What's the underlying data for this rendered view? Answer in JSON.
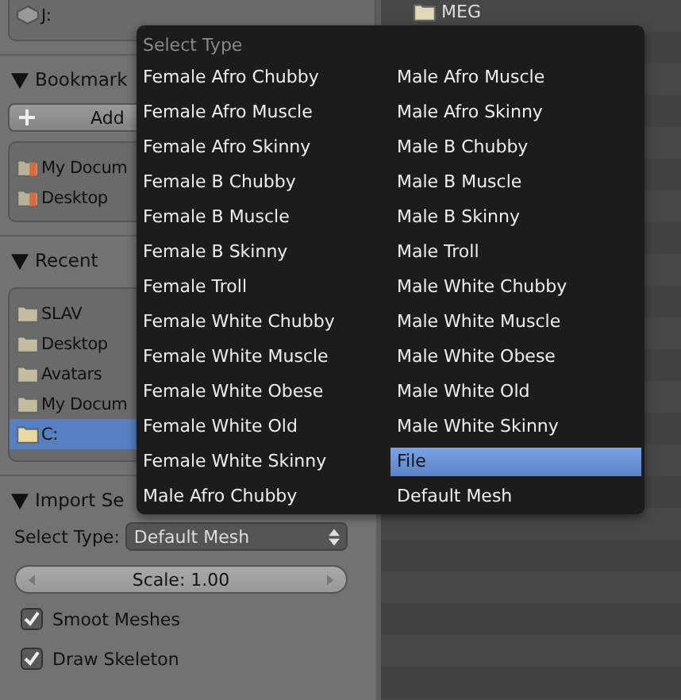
{
  "drive_box": {
    "label": "J:"
  },
  "bookmarks": {
    "title": "Bookmark",
    "expanded": true,
    "add_button": "Add",
    "items": [
      {
        "label": "My Docum",
        "selected": false
      },
      {
        "label": "Desktop",
        "selected": false
      }
    ]
  },
  "recent": {
    "title": "Recent",
    "expanded": true,
    "items": [
      {
        "label": "SLAV",
        "selected": false
      },
      {
        "label": "Desktop",
        "selected": false
      },
      {
        "label": "Avatars",
        "selected": false
      },
      {
        "label": "My Docum",
        "selected": false
      },
      {
        "label": "C:",
        "selected": true
      }
    ]
  },
  "import_panel": {
    "title": "Import Se",
    "expanded": true,
    "select_label": "Select Type:",
    "select_value": "Default Mesh",
    "scale": "Scale: 1.00",
    "checkboxes": [
      {
        "label": "Smoot Meshes",
        "checked": true
      },
      {
        "label": "Draw Skeleton",
        "checked": true
      }
    ]
  },
  "files": [
    {
      "name": "MEG"
    }
  ],
  "menu": {
    "title": "Select Type",
    "columns": [
      [
        {
          "label": "Female Afro Chubby",
          "selected": false
        },
        {
          "label": "Female Afro Muscle",
          "selected": false
        },
        {
          "label": "Female Afro Skinny",
          "selected": false
        },
        {
          "label": "Female B Chubby",
          "selected": false
        },
        {
          "label": "Female B Muscle",
          "selected": false
        },
        {
          "label": "Female B Skinny",
          "selected": false
        },
        {
          "label": "Female Troll",
          "selected": false
        },
        {
          "label": "Female White Chubby",
          "selected": false
        },
        {
          "label": "Female White Muscle",
          "selected": false
        },
        {
          "label": "Female White Obese",
          "selected": false
        },
        {
          "label": "Female White Old",
          "selected": false
        },
        {
          "label": "Female White Skinny",
          "selected": false
        },
        {
          "label": "Male Afro Chubby",
          "selected": false
        }
      ],
      [
        {
          "label": "Male Afro Muscle",
          "selected": false
        },
        {
          "label": "Male Afro Skinny",
          "selected": false
        },
        {
          "label": "Male B Chubby",
          "selected": false
        },
        {
          "label": "Male B Muscle",
          "selected": false
        },
        {
          "label": "Male B Skinny",
          "selected": false
        },
        {
          "label": "Male Troll",
          "selected": false
        },
        {
          "label": "Male White Chubby",
          "selected": false
        },
        {
          "label": "Male White Muscle",
          "selected": false
        },
        {
          "label": "Male White Obese",
          "selected": false
        },
        {
          "label": "Male White Old",
          "selected": false
        },
        {
          "label": "Male White Skinny",
          "selected": false
        },
        {
          "label": "File",
          "selected": true
        },
        {
          "label": "Default Mesh",
          "selected": false
        }
      ]
    ]
  }
}
